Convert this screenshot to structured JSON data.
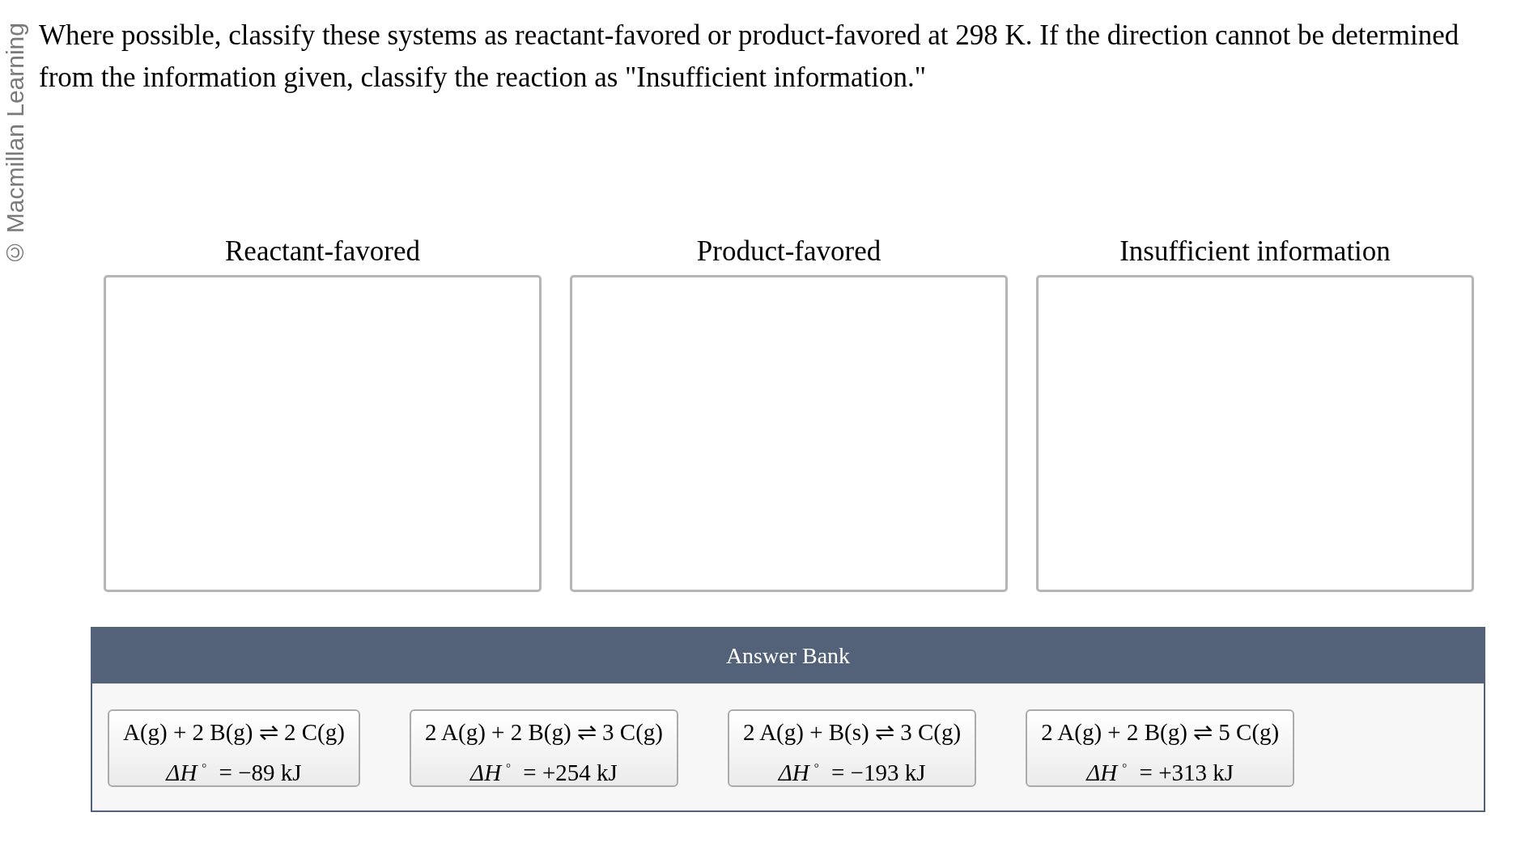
{
  "copyright": "© Macmillan Learning",
  "prompt": "Where possible, classify these systems as reactant-favored or product-favored at 298 K. If the direction cannot be determined from the information given, classify the reaction as \"Insufficient information.\"",
  "categories": [
    {
      "label": "Reactant-favored"
    },
    {
      "label": "Product-favored"
    },
    {
      "label": "Insufficient information"
    }
  ],
  "answer_bank": {
    "title": "Answer Bank",
    "items": [
      {
        "equation": "A(g) + 2 B(g) ⇌ 2 C(g)",
        "enthalpy": "*ΔH*$^{°}$ = −89 kJ"
      },
      {
        "equation": "2 A(g) + 2 B(g) ⇌ 3 C(g)",
        "enthalpy": "*ΔH*$^{°}$ = +254 kJ"
      },
      {
        "equation": "2 A(g) + B(s) ⇌ 3 C(g)",
        "enthalpy": "*ΔH*$^{°}$ = −193 kJ"
      },
      {
        "equation": "2 A(g) + 2 B(g) ⇌ 5 C(g)",
        "enthalpy": "*ΔH*$^{°}$ = +313 kJ"
      }
    ]
  }
}
